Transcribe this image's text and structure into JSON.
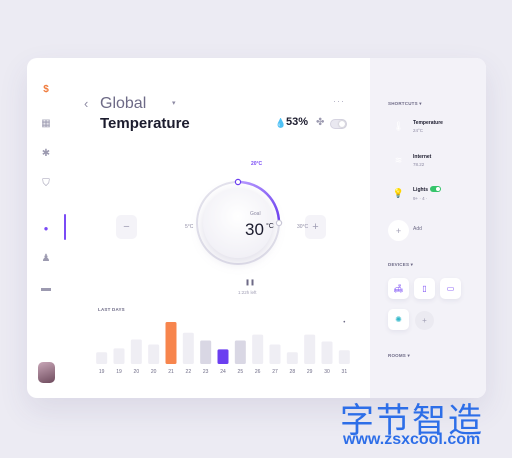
{
  "sidebar": {
    "items": [
      {
        "name": "dollar-icon",
        "glyph": "$",
        "color": "#f07a3a"
      },
      {
        "name": "dashboard-icon",
        "glyph": "▦",
        "color": "#9c9ab0"
      },
      {
        "name": "settings-icon",
        "glyph": "✱",
        "color": "#9c9ab0"
      },
      {
        "name": "filter-icon",
        "glyph": "⛉",
        "color": "#9c9ab0"
      },
      {
        "name": "location-icon",
        "glyph": "●",
        "color": "#7a4bf5"
      },
      {
        "name": "person-icon",
        "glyph": "♟",
        "color": "#9c9ab0"
      },
      {
        "name": "trash-icon",
        "glyph": "▬",
        "color": "#9c9ab0"
      }
    ]
  },
  "header": {
    "back_glyph": "‹",
    "location": "Global",
    "caret": "▾",
    "title": "Temperature",
    "more": "···",
    "drop_glyph": "💧",
    "humidity": "53%",
    "fan_glyph": "✤"
  },
  "thermostat": {
    "min_label": "5°C",
    "max_label": "30°C",
    "current_label": "20°C",
    "goal_label": "Goal",
    "goal_value": "30",
    "goal_unit": "°C",
    "minus": "−",
    "plus": "+",
    "pause_glyph": "❚❚",
    "time_left": "1:22h left",
    "progress": 0.63
  },
  "chart_data": {
    "type": "bar",
    "title": "LAST DAYS",
    "categories": [
      "19",
      "19",
      "20",
      "20",
      "21",
      "22",
      "23",
      "24",
      "25",
      "26",
      "27",
      "28",
      "29",
      "30",
      "31"
    ],
    "values": [
      12,
      16,
      25,
      20,
      43,
      32,
      24,
      15,
      24,
      30,
      20,
      12,
      30,
      23,
      14
    ],
    "highlight": {
      "4": "#f7854d",
      "7": "#6b3ef0"
    },
    "gray_indices": [
      6,
      8
    ],
    "ylim": [
      0,
      45
    ]
  },
  "chart_extra": {
    "top_marker": "•"
  },
  "right_panel": {
    "shortcuts_label": "SHORTCUTS ▾",
    "shortcuts": [
      {
        "name": "Temperature",
        "sub": "24°C",
        "color": "#6b3ef0",
        "glyph": "🌡"
      },
      {
        "name": "Internet",
        "sub": "78.22",
        "color": "#f7854d",
        "glyph": "≋"
      },
      {
        "name": "Lights",
        "sub": "9+ · 4 ·",
        "color": "#f8c43a",
        "glyph": "💡"
      }
    ],
    "add_label": "Add",
    "add_glyph": "+",
    "devices_label": "DEVICES ▾",
    "devices": [
      {
        "name": "lamp-device-icon",
        "glyph": "🛋"
      },
      {
        "name": "fridge-device-icon",
        "glyph": "▯"
      },
      {
        "name": "monitor-device-icon",
        "glyph": "▭"
      },
      {
        "name": "bulb-device-icon",
        "glyph": "✺"
      }
    ],
    "device_add_glyph": "+",
    "rooms_label": "ROOMS ▾"
  },
  "watermark": {
    "chinese": "字节智造",
    "url": "www.zsxcool.com"
  }
}
